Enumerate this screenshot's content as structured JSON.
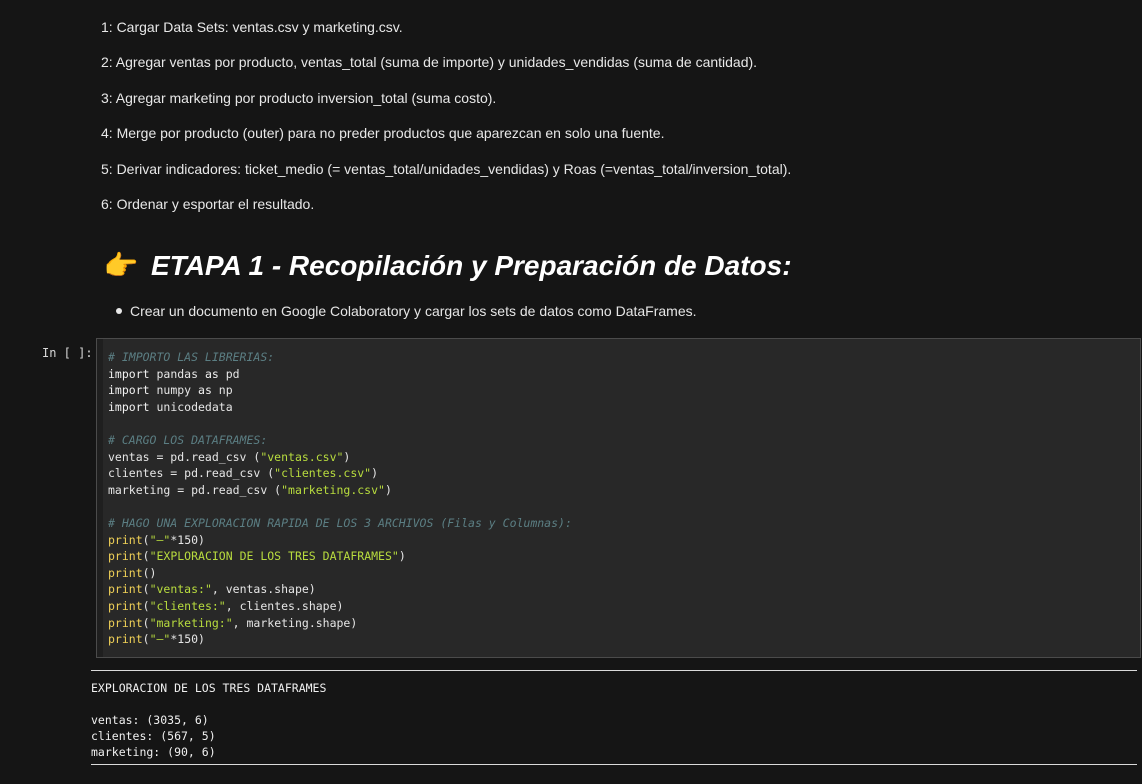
{
  "markdown_cells": {
    "steps": [
      "1: Cargar Data Sets: ventas.csv y marketing.csv.",
      "2: Agregar ventas por producto, ventas_total (suma de importe) y unidades_vendidas (suma de cantidad).",
      "3: Agregar marketing por producto inversion_total (suma costo).",
      "4: Merge por producto (outer) para no preder productos que aparezcan en solo una fuente.",
      "5: Derivar indicadores: ticket_medio (= ventas_total/unidades_vendidas) y Roas (=ventas_total/inversion_total).",
      "6: Ordenar y esportar el resultado."
    ],
    "heading": {
      "icon": "pointing-hand-icon",
      "icon_glyph": "👉",
      "text": "ETAPA 1 - Recopilación y Preparación de Datos:"
    },
    "bullet": "Crear un documento en Google Colaboratory y cargar los sets de datos como DataFrames."
  },
  "code_cell": {
    "prompt": "In [ ]:",
    "lines": [
      [
        {
          "cls": "c",
          "text": "# IMPORTO LAS LIBRERIAS:"
        }
      ],
      [
        {
          "cls": "k",
          "text": "import"
        },
        {
          "cls": "n",
          "text": " pandas "
        },
        {
          "cls": "k",
          "text": "as"
        },
        {
          "cls": "n",
          "text": " pd"
        }
      ],
      [
        {
          "cls": "k",
          "text": "import"
        },
        {
          "cls": "n",
          "text": " numpy "
        },
        {
          "cls": "k",
          "text": "as"
        },
        {
          "cls": "n",
          "text": " np"
        }
      ],
      [
        {
          "cls": "k",
          "text": "import"
        },
        {
          "cls": "n",
          "text": " unicodedata"
        }
      ],
      [
        {
          "cls": "n",
          "text": ""
        }
      ],
      [
        {
          "cls": "c",
          "text": "# CARGO LOS DATAFRAMES:"
        }
      ],
      [
        {
          "cls": "n",
          "text": "ventas = pd.read_csv ("
        },
        {
          "cls": "s",
          "text": "\"ventas.csv\""
        },
        {
          "cls": "n",
          "text": ")"
        }
      ],
      [
        {
          "cls": "n",
          "text": "clientes = pd.read_csv ("
        },
        {
          "cls": "s",
          "text": "\"clientes.csv\""
        },
        {
          "cls": "n",
          "text": ")"
        }
      ],
      [
        {
          "cls": "n",
          "text": "marketing = pd.read_csv ("
        },
        {
          "cls": "s",
          "text": "\"marketing.csv\""
        },
        {
          "cls": "n",
          "text": ")"
        }
      ],
      [
        {
          "cls": "n",
          "text": ""
        }
      ],
      [
        {
          "cls": "c",
          "text": "# HAGO UNA EXPLORACION RAPIDA DE LOS 3 ARCHIVOS (Filas y Columnas):"
        }
      ],
      [
        {
          "cls": "f",
          "text": "print"
        },
        {
          "cls": "n",
          "text": "("
        },
        {
          "cls": "s",
          "text": "\"—\""
        },
        {
          "cls": "n",
          "text": "*150)"
        }
      ],
      [
        {
          "cls": "f",
          "text": "print"
        },
        {
          "cls": "n",
          "text": "("
        },
        {
          "cls": "s",
          "text": "\"EXPLORACION DE LOS TRES DATAFRAMES\""
        },
        {
          "cls": "n",
          "text": ")"
        }
      ],
      [
        {
          "cls": "f",
          "text": "print"
        },
        {
          "cls": "n",
          "text": "()"
        }
      ],
      [
        {
          "cls": "f",
          "text": "print"
        },
        {
          "cls": "n",
          "text": "("
        },
        {
          "cls": "s",
          "text": "\"ventas:\""
        },
        {
          "cls": "n",
          "text": ", ventas.shape)"
        }
      ],
      [
        {
          "cls": "f",
          "text": "print"
        },
        {
          "cls": "n",
          "text": "("
        },
        {
          "cls": "s",
          "text": "\"clientes:\""
        },
        {
          "cls": "n",
          "text": ", clientes.shape)"
        }
      ],
      [
        {
          "cls": "f",
          "text": "print"
        },
        {
          "cls": "n",
          "text": "("
        },
        {
          "cls": "s",
          "text": "\"marketing:\""
        },
        {
          "cls": "n",
          "text": ", marketing.shape)"
        }
      ],
      [
        {
          "cls": "f",
          "text": "print"
        },
        {
          "cls": "n",
          "text": "("
        },
        {
          "cls": "s",
          "text": "\"—\""
        },
        {
          "cls": "n",
          "text": "*150)"
        }
      ]
    ]
  },
  "output": {
    "title": "EXPLORACION DE LOS TRES DATAFRAMES",
    "lines": [
      "ventas: (3035, 6)",
      "clientes: (567, 5)",
      "marketing: (90, 6)"
    ]
  }
}
